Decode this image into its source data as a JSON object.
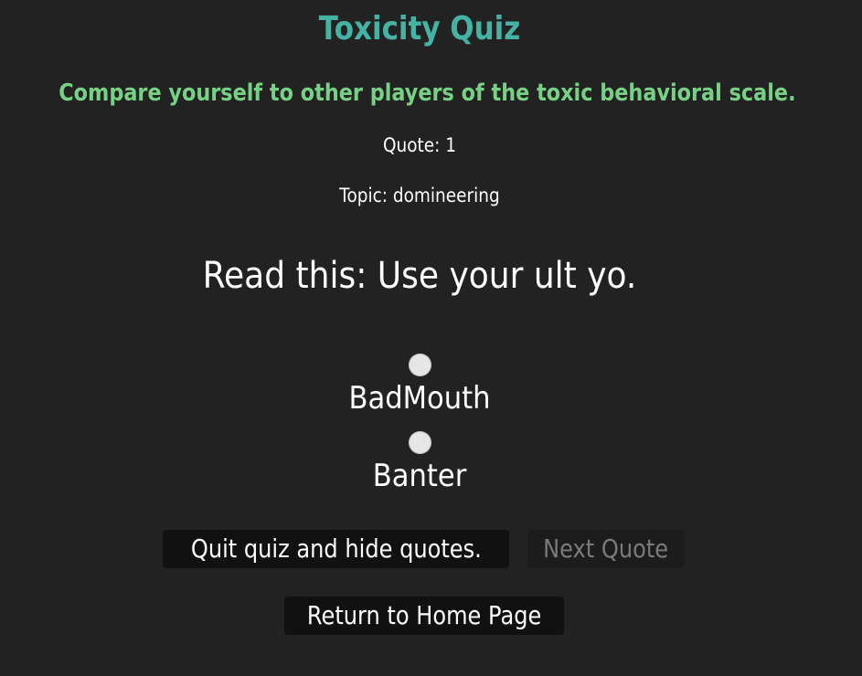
{
  "header": {
    "title": "Toxicity Quiz",
    "subtitle": "Compare yourself to other players of the toxic behavioral scale."
  },
  "quiz": {
    "quote_number": "Quote: 1",
    "topic": "Topic: domineering",
    "prompt": "Read this: Use your ult yo.",
    "options": [
      {
        "label": "BadMouth",
        "selected": false
      },
      {
        "label": "Banter",
        "selected": false
      }
    ]
  },
  "buttons": {
    "quit_label": "Quit quiz and hide quotes.",
    "next_label": "Next Quote",
    "next_disabled": true,
    "home_label": "Return to Home Page"
  },
  "colors": {
    "background": "#222222",
    "title": "#45b3a4",
    "subtitle": "#77d185",
    "button_bg": "#111111",
    "disabled_text": "#7a7a7a"
  }
}
